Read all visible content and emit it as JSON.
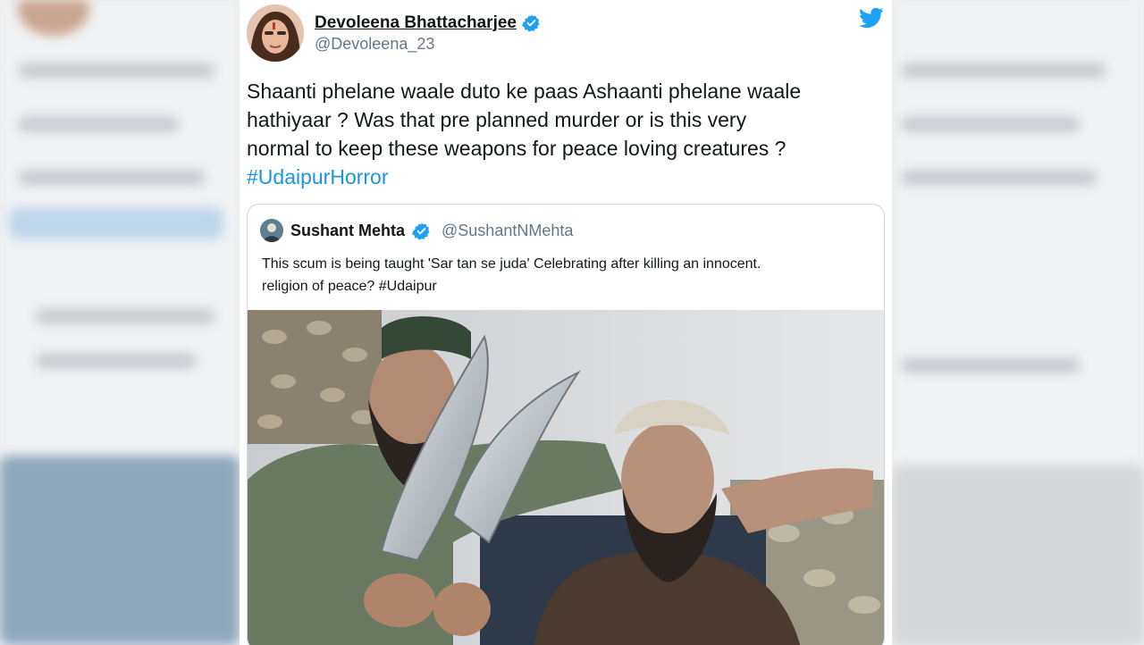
{
  "tweet": {
    "author": {
      "name": "Devoleena Bhattacharjee",
      "handle": "@Devoleena_23",
      "verified": true
    },
    "lines": [
      "Shaanti phelane waale duto ke paas Ashaanti phelane waale",
      "hathiyaar ? Was that pre planned murder or is this very",
      "normal to keep these weapons for peace loving creatures ?"
    ],
    "hashtag": "#UdaipurHorror",
    "platform_icon": "twitter-bird-icon"
  },
  "quoted_tweet": {
    "author": {
      "name": "Sushant Mehta",
      "handle": "@SushantNMehta",
      "verified": true
    },
    "lines": [
      "This scum is being taught 'Sar tan se juda' Celebrating after killing an innocent.",
      "religion of peace? #Udaipur"
    ],
    "media_description_icon": "photo"
  },
  "colors": {
    "link_blue": "#1b95e0",
    "verified_blue": "#1da1f2",
    "text": "#14171a",
    "muted": "#657786"
  }
}
